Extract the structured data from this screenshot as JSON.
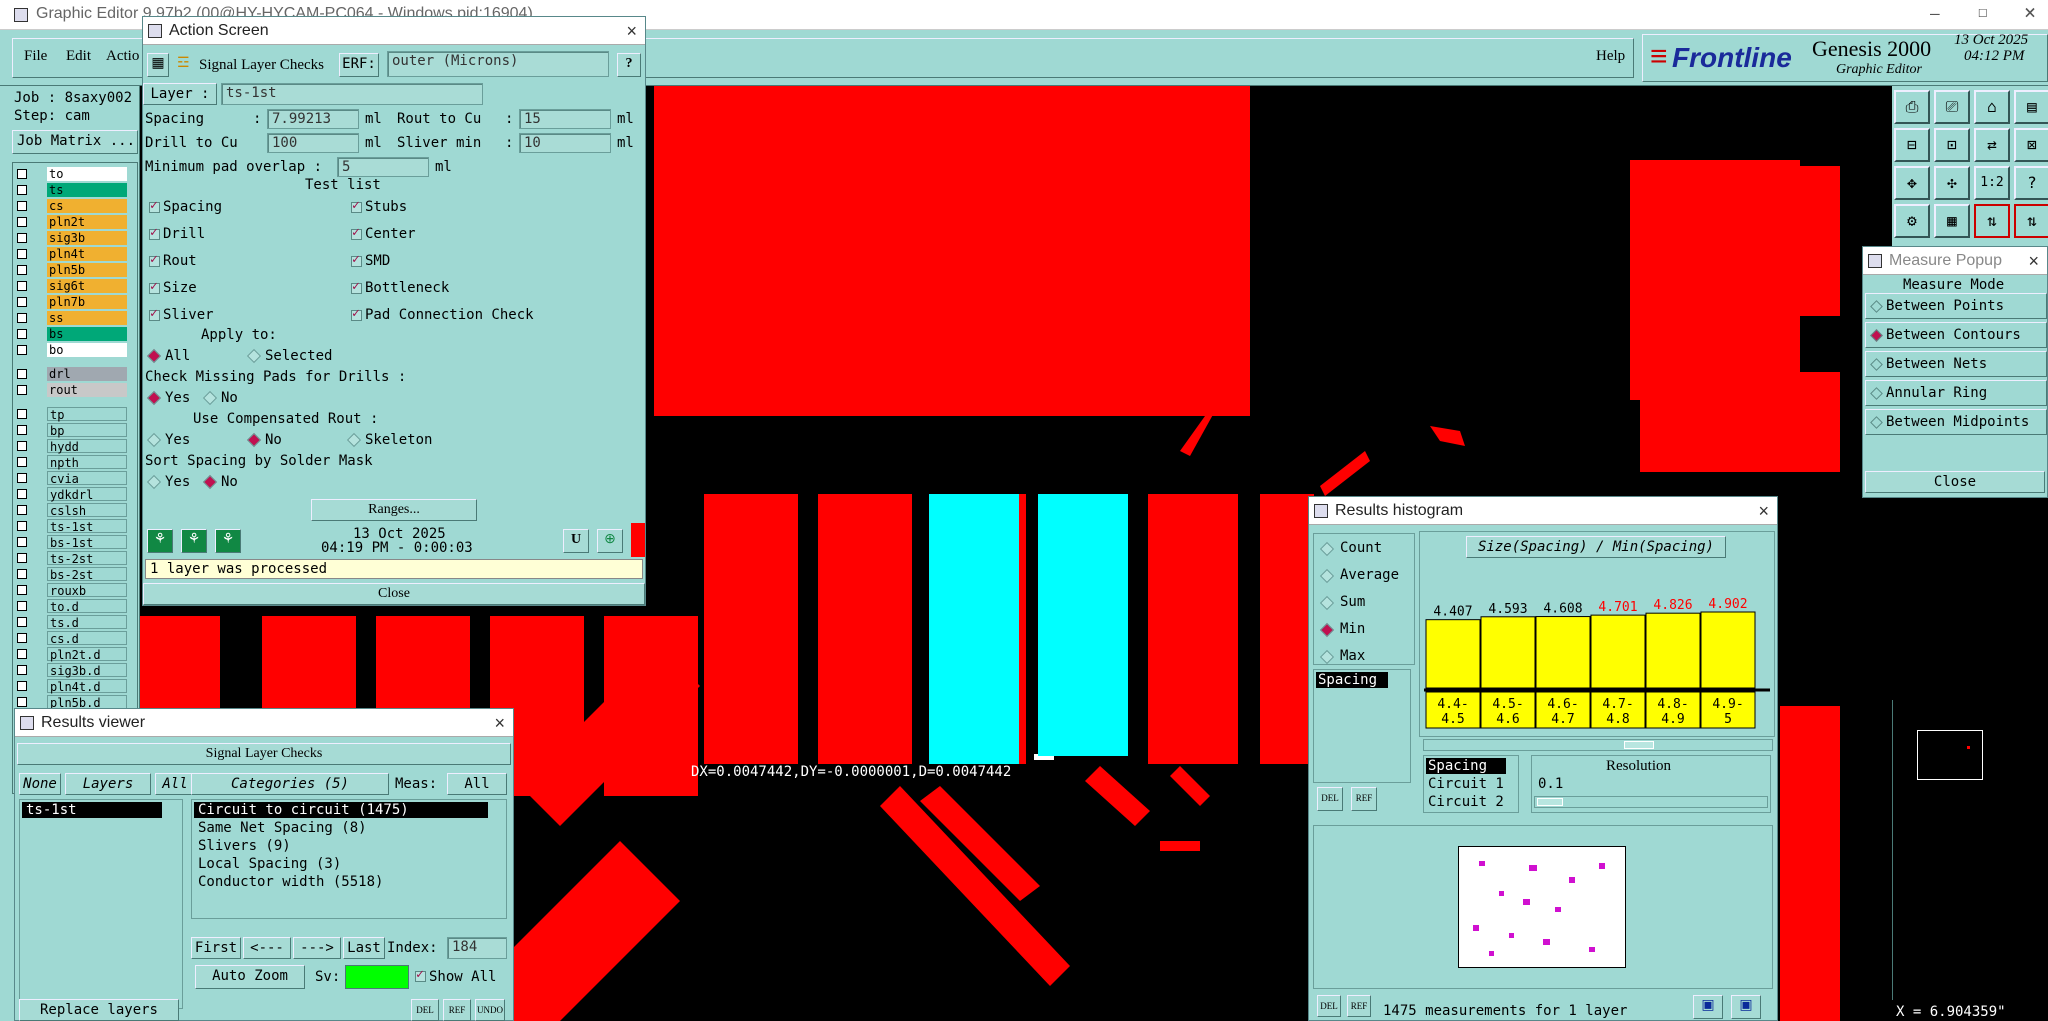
{
  "main_window": {
    "title": "Graphic Editor 9.97b2 (00@HY-HYCAM-PC064 - Windows pid:16904)",
    "menu": [
      "File",
      "Edit",
      "Actio"
    ],
    "help": "Help",
    "brand": "Frontline",
    "product": "Genesis 2000",
    "subtitle": "Graphic Editor",
    "date": "13 Oct 2025",
    "time": "04:12 PM",
    "job": "Job : 8saxy002",
    "step": "Step: cam",
    "job_matrix": "Job Matrix ..."
  },
  "layers": [
    {
      "name": "to",
      "color": "#ffffff"
    },
    {
      "name": "ts",
      "color": "#00a878"
    },
    {
      "name": "cs",
      "color": "#f0b030"
    },
    {
      "name": "pln2t",
      "color": "#f0b030"
    },
    {
      "name": "sig3b",
      "color": "#f0b030"
    },
    {
      "name": "pln4t",
      "color": "#f0b030"
    },
    {
      "name": "pln5b",
      "color": "#f0b030"
    },
    {
      "name": "sig6t",
      "color": "#f0b030"
    },
    {
      "name": "pln7b",
      "color": "#f0b030"
    },
    {
      "name": "ss",
      "color": "#f0b030"
    },
    {
      "name": "bs",
      "color": "#00a878"
    },
    {
      "name": "bo",
      "color": "#ffffff"
    },
    {
      "name": "drl",
      "color": "#a0a8b0"
    },
    {
      "name": "rout",
      "color": "#c8c8c8"
    },
    {
      "name": "tp",
      "color": "#9fd9d3"
    },
    {
      "name": "bp",
      "color": "#9fd9d3"
    },
    {
      "name": "hydd",
      "color": "#9fd9d3"
    },
    {
      "name": "npth",
      "color": "#9fd9d3"
    },
    {
      "name": "cvia",
      "color": "#9fd9d3"
    },
    {
      "name": "ydkdrl",
      "color": "#9fd9d3"
    },
    {
      "name": "cslsh",
      "color": "#9fd9d3"
    },
    {
      "name": "ts-1st",
      "color": "#9fd9d3"
    },
    {
      "name": "bs-1st",
      "color": "#9fd9d3"
    },
    {
      "name": "ts-2st",
      "color": "#9fd9d3"
    },
    {
      "name": "bs-2st",
      "color": "#9fd9d3"
    },
    {
      "name": "rouxb",
      "color": "#9fd9d3"
    },
    {
      "name": "to.d",
      "color": "#9fd9d3"
    },
    {
      "name": "ts.d",
      "color": "#9fd9d3"
    },
    {
      "name": "cs.d",
      "color": "#9fd9d3"
    },
    {
      "name": "pln2t.d",
      "color": "#9fd9d3"
    },
    {
      "name": "sig3b.d",
      "color": "#9fd9d3"
    },
    {
      "name": "pln4t.d",
      "color": "#9fd9d3"
    },
    {
      "name": "pln5b.d",
      "color": "#9fd9d3"
    }
  ],
  "action": {
    "title": "Action Screen",
    "check_name": "Signal Layer Checks",
    "erf_label": "ERF:",
    "erf_value": "outer (Microns)",
    "layer_label": "Layer :",
    "layer_value": "ts-1st",
    "spacing_label": "Spacing",
    "spacing_value": "7.99213",
    "rout_label": "Rout to Cu",
    "rout_value": "15",
    "drill_label": "Drill to Cu",
    "drill_value": "100",
    "sliver_label": "Sliver min",
    "sliver_value": "10",
    "overlap_label": "Minimum pad overlap :",
    "overlap_value": "5",
    "unit": "ml",
    "test_list": "Test list",
    "tests_left": [
      "Spacing",
      "Drill",
      "Rout",
      "Size",
      "Sliver"
    ],
    "tests_right": [
      "Stubs",
      "Center",
      "SMD",
      "Bottleneck",
      "Pad Connection Check"
    ],
    "apply_to": "Apply to:",
    "all": "All",
    "selected": "Selected",
    "missing_pads": "Check Missing Pads for Drills :",
    "yes": "Yes",
    "no": "No",
    "comp_rout": "Use Compensated Rout :",
    "skeleton": "Skeleton",
    "sort_spacing": "Sort Spacing by Solder Mask",
    "ranges": "Ranges...",
    "date": "13 Oct 2025",
    "time": "04:19 PM - 0:00:03",
    "status": "1 layer was processed",
    "close": "Close"
  },
  "results_viewer": {
    "title": "Results viewer",
    "header": "Signal Layer Checks",
    "none": "None",
    "layers": "Layers",
    "all": "All",
    "categories": "Categories (5)",
    "meas": "Meas:",
    "meas_value": "All",
    "layer_item": "ts-1st",
    "category_items": [
      "Circuit to circuit (1475)",
      "Same Net Spacing (8)",
      "Slivers (9)",
      "Local Spacing (3)",
      "Conductor width (5518)"
    ],
    "first": "First",
    "prev": "<---",
    "next": "--->",
    "last": "Last",
    "index_label": "Index:",
    "index_value": "184",
    "auto_zoom": "Auto Zoom",
    "sv": "Sv:",
    "show_all": "Show All",
    "replace": "Replace layers"
  },
  "measure_readout": "DX=0.0047442,DY=-0.0000001,D=0.0047442",
  "histogram": {
    "title": "Results histogram",
    "modes": [
      "Count",
      "Average",
      "Sum",
      "Min",
      "Max"
    ],
    "selected_mode": "Min",
    "heading": "Size(Spacing) / Min(Spacing)",
    "spacing_item": "Spacing",
    "lower_items": [
      "Spacing",
      "Circuit 1",
      "Circuit 2"
    ],
    "resolution_label": "Resolution",
    "resolution_value": "0.1",
    "footer": "1475 measurements for 1 layer"
  },
  "chart_data": {
    "type": "bar",
    "categories": [
      "4.4-4.5",
      "4.5-4.6",
      "4.6-4.7",
      "4.7-4.8",
      "4.8-4.9",
      "4.9-5"
    ],
    "values": [
      4.407,
      4.593,
      4.608,
      4.701,
      4.826,
      4.902
    ],
    "value_labels": [
      "4.407",
      "4.593",
      "4.608",
      "4.701",
      "4.826",
      "4.902"
    ],
    "cat_top": [
      "4.4-",
      "4.5-",
      "4.6-",
      "4.7-",
      "4.8-",
      "4.9-"
    ],
    "cat_bottom": [
      "4.5",
      "4.6",
      "4.7",
      "4.8",
      "4.9",
      "5"
    ],
    "label_colors": [
      "#000000",
      "#000000",
      "#000000",
      "#ff0000",
      "#ff0000",
      "#ff0000"
    ],
    "title": "Size(Spacing) / Min(Spacing)"
  },
  "measure_popup": {
    "title": "Measure Popup",
    "mode_label": "Measure Mode",
    "items": [
      "Between Points",
      "Between Contours",
      "Between Nets",
      "Annular Ring",
      "Between Midpoints"
    ],
    "selected": "Between Contours",
    "close": "Close"
  },
  "coord": "X = 6.904359\""
}
